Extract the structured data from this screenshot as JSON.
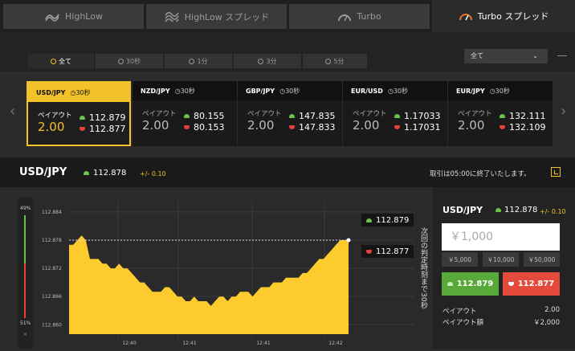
{
  "nav": {
    "tabs": [
      {
        "label": "HighLow",
        "icon": "highlow-icon"
      },
      {
        "label": "HighLow スプレッド",
        "icon": "highlow-spread-icon"
      },
      {
        "label": "Turbo",
        "icon": "speedometer-icon"
      },
      {
        "label": "Turbo スプレッド",
        "icon": "speedometer-icon",
        "active": true
      }
    ]
  },
  "filters": {
    "tabs": [
      "全て",
      "30秒",
      "1分",
      "3分",
      "5分"
    ],
    "dropdown_value": "全て"
  },
  "cards": [
    {
      "pair": "USD/JPY",
      "time": "30秒",
      "payout_label": "ペイアウト",
      "payout": "2.00",
      "high": "112.879",
      "low": "112.877",
      "selected": true
    },
    {
      "pair": "NZD/JPY",
      "time": "30秒",
      "payout_label": "ペイアウト",
      "payout": "2.00",
      "high": "80.155",
      "low": "80.153"
    },
    {
      "pair": "GBP/JPY",
      "time": "30秒",
      "payout_label": "ペイアウト",
      "payout": "2.00",
      "high": "147.835",
      "low": "147.833"
    },
    {
      "pair": "EUR/USD",
      "time": "30秒",
      "payout_label": "ペイアウト",
      "payout": "2.00",
      "high": "1.17033",
      "low": "1.17031"
    },
    {
      "pair": "EUR/JPY",
      "time": "30秒",
      "payout_label": "ペイアウト",
      "payout": "2.00",
      "high": "132.111",
      "low": "132.109"
    }
  ],
  "info": {
    "pair": "USD/JPY",
    "price": "112.878",
    "change": "+/- 0.10",
    "notice": "取引は05:00に終了いたします。"
  },
  "sentiment": {
    "up": "49%",
    "down": "51%",
    "close": "×"
  },
  "chart_data": {
    "type": "area",
    "ylabels": [
      "112.884",
      "112.878",
      "112.872",
      "112.866",
      "112.860"
    ],
    "yvalues": [
      112.884,
      112.878,
      112.872,
      112.866,
      112.86
    ],
    "xlabels": [
      "12:40",
      "12:41",
      "12:41",
      "12:42"
    ],
    "current": 112.878,
    "high_label": "112.879",
    "low_label": "112.877",
    "countdown_text": "次回の判定時刻まで30秒",
    "series": [
      112.877,
      112.877,
      112.878,
      112.879,
      112.878,
      112.874,
      112.874,
      112.874,
      112.873,
      112.873,
      112.872,
      112.872,
      112.873,
      112.872,
      112.872,
      112.871,
      112.87,
      112.869,
      112.869,
      112.868,
      112.867,
      112.867,
      112.867,
      112.868,
      112.868,
      112.867,
      112.866,
      112.866,
      112.865,
      112.865,
      112.866,
      112.865,
      112.865,
      112.865,
      112.864,
      112.865,
      112.866,
      112.866,
      112.865,
      112.866,
      112.866,
      112.867,
      112.867,
      112.867,
      112.866,
      112.867,
      112.868,
      112.868,
      112.868,
      112.869,
      112.869,
      112.869,
      112.87,
      112.87,
      112.87,
      112.87,
      112.871,
      112.871,
      112.872,
      112.873,
      112.874,
      112.874,
      112.875,
      112.876,
      112.877,
      112.878,
      112.878,
      112.878
    ]
  },
  "panel": {
    "pair": "USD/JPY",
    "price": "112.878",
    "change": "+/- 0.10",
    "amount": "￥1,000",
    "quick": [
      "￥5,000",
      "￥10,000",
      "￥50,000"
    ],
    "high_price": "112.879",
    "low_price": "112.877",
    "payout_label": "ペイアウト",
    "payout": "2.00",
    "payout_amount_label": "ペイアウト額",
    "payout_amount": "￥2,000"
  },
  "colors": {
    "accent": "#f3c129",
    "up": "#6cc24a",
    "down": "#e8413a"
  }
}
